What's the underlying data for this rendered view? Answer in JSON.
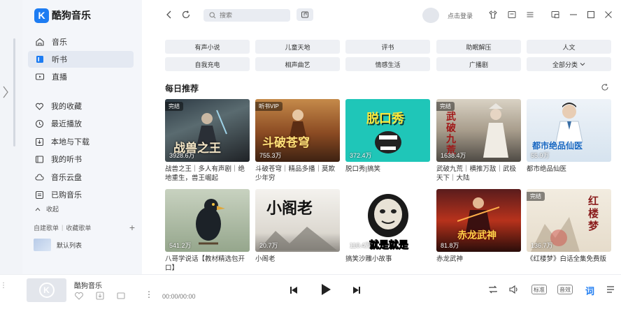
{
  "app": {
    "name": "酷狗音乐",
    "logo_letter": "K",
    "brand_color": "#1d7cf2"
  },
  "sidebar": {
    "nav": [
      {
        "label": "音乐",
        "icon": "home-icon"
      },
      {
        "label": "听书",
        "icon": "book-icon",
        "active": true
      },
      {
        "label": "直播",
        "icon": "live-icon"
      }
    ],
    "mine": [
      {
        "label": "我的收藏",
        "icon": "heart-icon"
      },
      {
        "label": "最近播放",
        "icon": "clock-icon"
      },
      {
        "label": "本地与下载",
        "icon": "download-icon"
      },
      {
        "label": "我的听书",
        "icon": "book-open-icon"
      },
      {
        "label": "音乐云盘",
        "icon": "cloud-icon"
      },
      {
        "label": "已购音乐",
        "icon": "purchased-icon"
      }
    ],
    "collapse_label": "收起",
    "playlist_tabs": [
      "自建歌单",
      "收藏歌单"
    ],
    "add_symbol": "+",
    "default_list": "默认列表"
  },
  "topbar": {
    "search_placeholder": "搜索",
    "login_label": "点击登录"
  },
  "categories": [
    "有声小说",
    "儿童天地",
    "评书",
    "助眠解压",
    "人文",
    "自我充电",
    "相声曲艺",
    "情感生活",
    "广播剧",
    "全部分类"
  ],
  "daily": {
    "title": "每日推荐",
    "items": [
      {
        "badge": "完结",
        "count": "3928.6万",
        "title": "战兽之王｜多人有声剧｜绝地重生，兽王崛起",
        "cover_text": "战兽之王"
      },
      {
        "badge": "听书VIP",
        "count": "755.3万",
        "title": "斗破苍穹｜精品多播｜莫欺少年穷",
        "cover_text": "斗破苍穹"
      },
      {
        "badge": "",
        "count": "372.4万",
        "title": "脱口秀|搞笑",
        "cover_text": "脱口秀"
      },
      {
        "badge": "完结",
        "count": "1638.4万",
        "title": "武破九荒｜横推万敌｜武极天下｜大陆",
        "cover_text": "武破九荒"
      },
      {
        "badge": "",
        "count": "55.9万",
        "title": "都市绝品仙医",
        "cover_text": "都市绝品仙医"
      },
      {
        "badge": "",
        "count": "541.2万",
        "title": "八哥学说话【教材精选包开口】",
        "cover_text": ""
      },
      {
        "badge": "",
        "count": "20.7万",
        "title": "小阁老",
        "cover_text": "小阁老"
      },
      {
        "badge": "",
        "count": "110.4万",
        "title": "搞笑沙雕小故事",
        "cover_text": "就是就是"
      },
      {
        "badge": "",
        "count": "81.8万",
        "title": "赤龙武神",
        "cover_text": "赤龙武神"
      },
      {
        "badge": "完结",
        "count": "136.7万",
        "title": "《红楼梦》白话全集免费版",
        "cover_text": "红楼梦"
      }
    ]
  },
  "player": {
    "title": "酷狗音乐",
    "time": "00:00/00:00",
    "quality_label": "标准",
    "effect_label": "音效",
    "lyric_label": "词"
  }
}
